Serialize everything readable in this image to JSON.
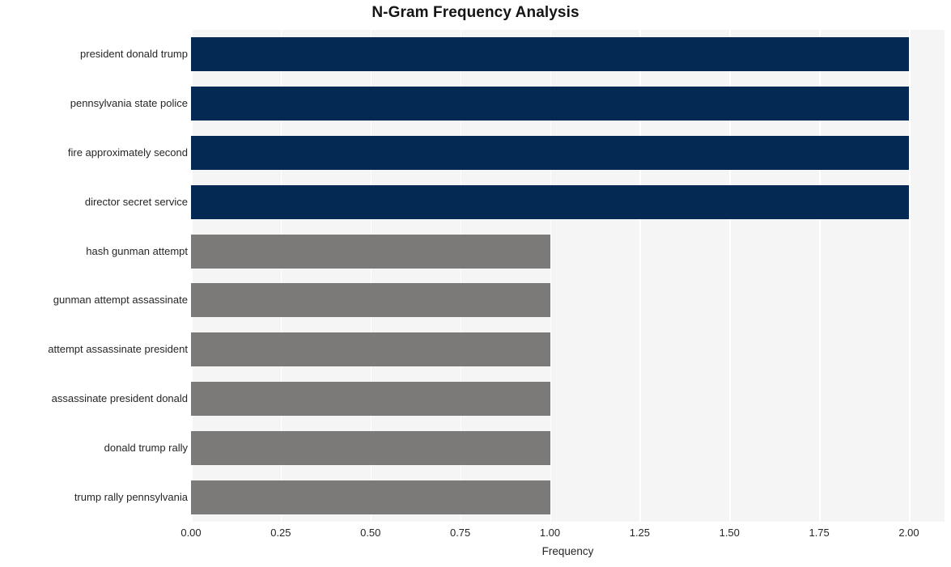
{
  "chart_data": {
    "type": "bar",
    "orientation": "horizontal",
    "title": "N-Gram Frequency Analysis",
    "xlabel": "Frequency",
    "ylabel": "",
    "xlim": [
      0.0,
      2.0
    ],
    "xticks": [
      "0.00",
      "0.25",
      "0.50",
      "0.75",
      "1.00",
      "1.25",
      "1.50",
      "1.75",
      "2.00"
    ],
    "xtick_values": [
      0.0,
      0.25,
      0.5,
      0.75,
      1.0,
      1.25,
      1.5,
      1.75,
      2.0
    ],
    "grid": true,
    "grid_axis": "both",
    "legend": "none",
    "categories": [
      "president donald trump",
      "pennsylvania state police",
      "fire approximately second",
      "director secret service",
      "hash gunman attempt",
      "gunman attempt assassinate",
      "attempt assassinate president",
      "assassinate president donald",
      "donald trump rally",
      "trump rally pennsylvania"
    ],
    "values": [
      2,
      2,
      2,
      2,
      1,
      1,
      1,
      1,
      1,
      1
    ],
    "bar_colors": [
      "#042a54",
      "#042a54",
      "#042a54",
      "#042a54",
      "#7b7a78",
      "#7b7a78",
      "#7b7a78",
      "#7b7a78",
      "#7b7a78",
      "#7b7a78"
    ],
    "bars": [
      {
        "label": "president donald trump",
        "value": 2,
        "color": "#042a54"
      },
      {
        "label": "pennsylvania state police",
        "value": 2,
        "color": "#042a54"
      },
      {
        "label": "fire approximately second",
        "value": 2,
        "color": "#042a54"
      },
      {
        "label": "director secret service",
        "value": 2,
        "color": "#042a54"
      },
      {
        "label": "hash gunman attempt",
        "value": 1,
        "color": "#7b7a78"
      },
      {
        "label": "gunman attempt assassinate",
        "value": 1,
        "color": "#7b7a78"
      },
      {
        "label": "attempt assassinate president",
        "value": 1,
        "color": "#7b7a78"
      },
      {
        "label": "assassinate president donald",
        "value": 1,
        "color": "#7b7a78"
      },
      {
        "label": "donald trump rally",
        "value": 1,
        "color": "#7b7a78"
      },
      {
        "label": "trump rally pennsylvania",
        "value": 1,
        "color": "#7b7a78"
      }
    ]
  },
  "style": {
    "figure_background": "#ffffff",
    "plot_background": "#f5f5f5",
    "gridline_color": "#ffffff",
    "text_color": "#262626",
    "title_color": "#141414"
  }
}
